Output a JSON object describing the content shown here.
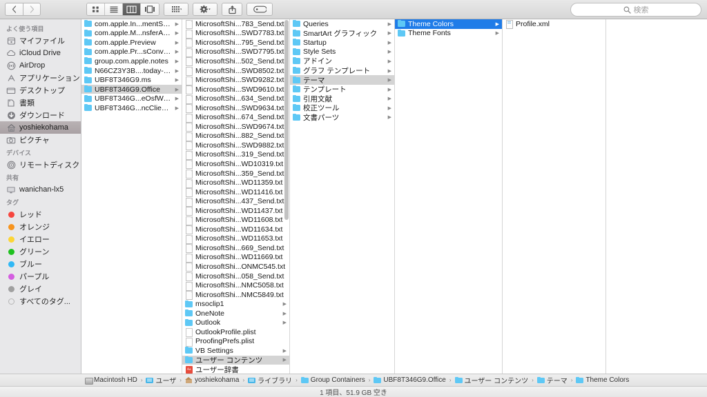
{
  "toolbar": {
    "back_label": "‹",
    "forward_label": "›",
    "view_buttons": [
      {
        "name": "icon-view",
        "label": "icon-grid-icon"
      },
      {
        "name": "list-view",
        "label": "list-lines-icon"
      },
      {
        "name": "column-view",
        "label": "column-view-icon"
      },
      {
        "name": "coverflow-view",
        "label": "coverflow-icon"
      }
    ],
    "arrange_label": "arrange-icon",
    "action_label": "gear-icon",
    "share_label": "share-icon",
    "tag_label": "tag-icon",
    "chevron": "∨"
  },
  "search": {
    "placeholder": "検索",
    "value": "",
    "icon": "search-icon"
  },
  "sidebar": {
    "sections": [
      {
        "header": "よく使う項目",
        "items": [
          {
            "label": "マイファイル",
            "icon": "myfiles-icon",
            "selected": false
          },
          {
            "label": "iCloud Drive",
            "icon": "icloud-icon",
            "selected": false
          },
          {
            "label": "AirDrop",
            "icon": "airdrop-icon",
            "selected": false
          },
          {
            "label": "アプリケーション",
            "icon": "applications-icon",
            "selected": false
          },
          {
            "label": "デスクトップ",
            "icon": "desktop-icon",
            "selected": false
          },
          {
            "label": "書類",
            "icon": "documents-icon",
            "selected": false
          },
          {
            "label": "ダウンロード",
            "icon": "downloads-icon",
            "selected": false
          },
          {
            "label": "yoshiekohama",
            "icon": "home-icon",
            "selected": true
          },
          {
            "label": "ピクチャ",
            "icon": "pictures-icon",
            "selected": false
          }
        ]
      },
      {
        "header": "デバイス",
        "items": [
          {
            "label": "リモートディスク",
            "icon": "remote-disc-icon",
            "selected": false
          }
        ]
      },
      {
        "header": "共有",
        "items": [
          {
            "label": "wanichan-lx5",
            "icon": "display-icon",
            "selected": false
          }
        ]
      },
      {
        "header": "タグ",
        "items": [
          {
            "label": "レッド",
            "icon": "tag-dot-icon",
            "color": "#f6463f",
            "selected": false
          },
          {
            "label": "オレンジ",
            "icon": "tag-dot-icon",
            "color": "#f7941e",
            "selected": false
          },
          {
            "label": "イエロー",
            "icon": "tag-dot-icon",
            "color": "#fcd535",
            "selected": false
          },
          {
            "label": "グリーン",
            "icon": "tag-dot-icon",
            "color": "#1fc11f",
            "selected": false
          },
          {
            "label": "ブルー",
            "icon": "tag-dot-icon",
            "color": "#30b8f5",
            "selected": false
          },
          {
            "label": "パープル",
            "icon": "tag-dot-icon",
            "color": "#d45ee0",
            "selected": false
          },
          {
            "label": "グレイ",
            "icon": "tag-dot-icon",
            "color": "#a0a0a0",
            "selected": false
          },
          {
            "label": "すべてのタグ...",
            "icon": "all-tags-icon",
            "color": "",
            "selected": false
          }
        ]
      }
    ]
  },
  "columns": [
    {
      "name": "group-containers-column",
      "rows": [
        {
          "label": "com.apple.In...mentService",
          "icon": "folder",
          "arrow": true,
          "state": ""
        },
        {
          "label": "com.apple.M...nsferArchive",
          "icon": "folder",
          "arrow": true,
          "state": ""
        },
        {
          "label": "com.apple.Preview",
          "icon": "folder",
          "arrow": true,
          "state": ""
        },
        {
          "label": "com.apple.Pr...sConversion",
          "icon": "folder",
          "arrow": true,
          "state": ""
        },
        {
          "label": "group.com.apple.notes",
          "icon": "folder",
          "arrow": true,
          "state": ""
        },
        {
          "label": "N66CZ3Y3B....today-group",
          "icon": "folder",
          "arrow": true,
          "state": ""
        },
        {
          "label": "UBF8T346G9.ms",
          "icon": "folder",
          "arrow": true,
          "state": ""
        },
        {
          "label": "UBF8T346G9.Office",
          "icon": "folder",
          "arrow": true,
          "state": "gray"
        },
        {
          "label": "UBF8T346G...eOsfWebHost",
          "icon": "folder",
          "arrow": true,
          "state": ""
        },
        {
          "label": "UBF8T346G...ncClientSuite",
          "icon": "folder",
          "arrow": true,
          "state": ""
        }
      ]
    },
    {
      "name": "office-contents-column",
      "rows": [
        {
          "label": "MicrosoftShi...783_Send.txt",
          "icon": "doc",
          "arrow": false,
          "state": ""
        },
        {
          "label": "MicrosoftShi...SWD7783.txt",
          "icon": "doc",
          "arrow": false,
          "state": ""
        },
        {
          "label": "MicrosoftShi...795_Send.txt",
          "icon": "doc",
          "arrow": false,
          "state": ""
        },
        {
          "label": "MicrosoftShi...SWD7795.txt",
          "icon": "doc",
          "arrow": false,
          "state": ""
        },
        {
          "label": "MicrosoftShi...502_Send.txt",
          "icon": "doc",
          "arrow": false,
          "state": ""
        },
        {
          "label": "MicrosoftShi...SWD8502.txt",
          "icon": "doc",
          "arrow": false,
          "state": ""
        },
        {
          "label": "MicrosoftShi...SWD9282.txt",
          "icon": "doc",
          "arrow": false,
          "state": ""
        },
        {
          "label": "MicrosoftShi...SWD9610.txt",
          "icon": "doc",
          "arrow": false,
          "state": ""
        },
        {
          "label": "MicrosoftShi...634_Send.txt",
          "icon": "doc",
          "arrow": false,
          "state": ""
        },
        {
          "label": "MicrosoftShi...SWD9634.txt",
          "icon": "doc",
          "arrow": false,
          "state": ""
        },
        {
          "label": "MicrosoftShi...674_Send.txt",
          "icon": "doc",
          "arrow": false,
          "state": ""
        },
        {
          "label": "MicrosoftShi...SWD9674.txt",
          "icon": "doc",
          "arrow": false,
          "state": ""
        },
        {
          "label": "MicrosoftShi...882_Send.txt",
          "icon": "doc",
          "arrow": false,
          "state": ""
        },
        {
          "label": "MicrosoftShi...SWD9882.txt",
          "icon": "doc",
          "arrow": false,
          "state": ""
        },
        {
          "label": "MicrosoftShi...319_Send.txt",
          "icon": "doc",
          "arrow": false,
          "state": ""
        },
        {
          "label": "MicrosoftShi...WD10319.txt",
          "icon": "doc",
          "arrow": false,
          "state": ""
        },
        {
          "label": "MicrosoftShi...359_Send.txt",
          "icon": "doc",
          "arrow": false,
          "state": ""
        },
        {
          "label": "MicrosoftShi...WD11359.txt",
          "icon": "doc",
          "arrow": false,
          "state": ""
        },
        {
          "label": "MicrosoftShi...WD11416.txt",
          "icon": "doc",
          "arrow": false,
          "state": ""
        },
        {
          "label": "MicrosoftShi...437_Send.txt",
          "icon": "doc",
          "arrow": false,
          "state": ""
        },
        {
          "label": "MicrosoftShi...WD11437.txt",
          "icon": "doc",
          "arrow": false,
          "state": ""
        },
        {
          "label": "MicrosoftShi...WD11608.txt",
          "icon": "doc",
          "arrow": false,
          "state": ""
        },
        {
          "label": "MicrosoftShi...WD11634.txt",
          "icon": "doc",
          "arrow": false,
          "state": ""
        },
        {
          "label": "MicrosoftShi...WD11653.txt",
          "icon": "doc",
          "arrow": false,
          "state": ""
        },
        {
          "label": "MicrosoftShi...669_Send.txt",
          "icon": "doc",
          "arrow": false,
          "state": ""
        },
        {
          "label": "MicrosoftShi...WD11669.txt",
          "icon": "doc",
          "arrow": false,
          "state": ""
        },
        {
          "label": "MicrosoftShi...ONMC545.txt",
          "icon": "doc",
          "arrow": false,
          "state": ""
        },
        {
          "label": "MicrosoftShi...058_Send.txt",
          "icon": "doc",
          "arrow": false,
          "state": ""
        },
        {
          "label": "MicrosoftShi...NMC5058.txt",
          "icon": "doc",
          "arrow": false,
          "state": ""
        },
        {
          "label": "MicrosoftShi...NMC5849.txt",
          "icon": "doc",
          "arrow": false,
          "state": ""
        },
        {
          "label": "msoclip1",
          "icon": "folder",
          "arrow": true,
          "state": ""
        },
        {
          "label": "OneNote",
          "icon": "folder",
          "arrow": true,
          "state": ""
        },
        {
          "label": "Outlook",
          "icon": "folder",
          "arrow": true,
          "state": ""
        },
        {
          "label": "OutlookProfile.plist",
          "icon": "plist",
          "arrow": false,
          "state": ""
        },
        {
          "label": "ProofingPrefs.plist",
          "icon": "plist",
          "arrow": false,
          "state": ""
        },
        {
          "label": "VB Settings",
          "icon": "folder",
          "arrow": true,
          "state": ""
        },
        {
          "label": "ユーザー コンテンツ",
          "icon": "folder",
          "arrow": true,
          "state": "gray"
        },
        {
          "label": "ユーザー辞書",
          "icon": "dict",
          "arrow": false,
          "state": ""
        }
      ]
    },
    {
      "name": "user-content-column",
      "rows": [
        {
          "label": "Queries",
          "icon": "folder",
          "arrow": true,
          "state": ""
        },
        {
          "label": "SmartArt グラフィック",
          "icon": "folder",
          "arrow": true,
          "state": ""
        },
        {
          "label": "Startup",
          "icon": "folder",
          "arrow": true,
          "state": ""
        },
        {
          "label": "Style Sets",
          "icon": "folder",
          "arrow": true,
          "state": ""
        },
        {
          "label": "アドイン",
          "icon": "folder",
          "arrow": true,
          "state": ""
        },
        {
          "label": "グラフ テンプレート",
          "icon": "folder",
          "arrow": true,
          "state": ""
        },
        {
          "label": "テーマ",
          "icon": "folder",
          "arrow": true,
          "state": "gray"
        },
        {
          "label": "テンプレート",
          "icon": "folder",
          "arrow": true,
          "state": ""
        },
        {
          "label": "引用文献",
          "icon": "folder",
          "arrow": true,
          "state": ""
        },
        {
          "label": "校正ツール",
          "icon": "folder",
          "arrow": true,
          "state": ""
        },
        {
          "label": "文書パーツ",
          "icon": "folder",
          "arrow": true,
          "state": ""
        }
      ]
    },
    {
      "name": "theme-column",
      "rows": [
        {
          "label": "Theme Colors",
          "icon": "folder",
          "arrow": true,
          "state": "blue"
        },
        {
          "label": "Theme Fonts",
          "icon": "folder",
          "arrow": true,
          "state": ""
        }
      ]
    },
    {
      "name": "theme-colors-column",
      "rows": [
        {
          "label": "Profile.xml",
          "icon": "doc-lines",
          "arrow": false,
          "state": ""
        }
      ]
    },
    {
      "name": "preview-column",
      "rows": []
    }
  ],
  "pathbar": {
    "items": [
      {
        "label": "Macintosh HD",
        "icon": "disk"
      },
      {
        "label": "ユーザ",
        "icon": "blue-folder"
      },
      {
        "label": "yoshiekohama",
        "icon": "home"
      },
      {
        "label": "ライブラリ",
        "icon": "blue-folder"
      },
      {
        "label": "Group Containers",
        "icon": "folder"
      },
      {
        "label": "UBF8T346G9.Office",
        "icon": "folder"
      },
      {
        "label": "ユーザー コンテンツ",
        "icon": "folder"
      },
      {
        "label": "テーマ",
        "icon": "folder"
      },
      {
        "label": "Theme Colors",
        "icon": "folder"
      }
    ],
    "separator": "›"
  },
  "statusbar": {
    "text": "1 項目、51.9 GB 空き"
  },
  "colors": {
    "selection_blue": "#1f7ce8",
    "selection_gray": "#d4d4d4",
    "sidebar_selected": "#b0a8ab",
    "folder_blue": "#5ec8f5"
  }
}
